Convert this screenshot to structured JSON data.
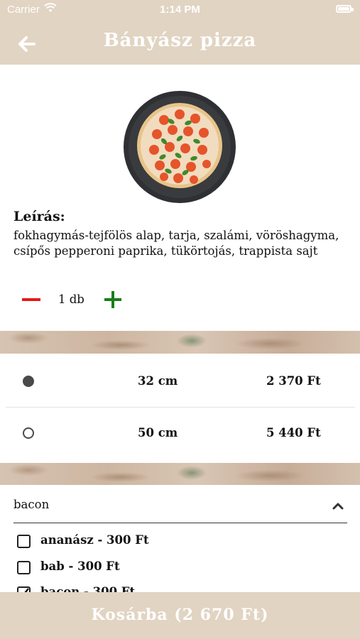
{
  "status_bar": {
    "carrier": "Carrier",
    "time": "1:14 PM"
  },
  "header": {
    "title": "Bányász pizza",
    "back_icon": "arrow-left-icon"
  },
  "product": {
    "image_icon": "pizza-image",
    "description_label": "Leírás:",
    "description": "fokhagymás-tejfölös alap, tarja, szalámi, vöröshagyma, csípős pepperoni paprika, tükörtojás, trappista sajt"
  },
  "quantity": {
    "value": "1 db",
    "minus_color": "#e11b1b",
    "plus_color": "#1b7d1b"
  },
  "sizes": [
    {
      "size": "32 cm",
      "price": "2 370 Ft",
      "selected": true
    },
    {
      "size": "50 cm",
      "price": "5 440 Ft",
      "selected": false
    }
  ],
  "extras": {
    "selected": "bacon",
    "options": [
      {
        "label": "ananász - 300 Ft",
        "checked": false
      },
      {
        "label": "bab - 300 Ft",
        "checked": false
      },
      {
        "label": "bacon - 300 Ft",
        "checked": true
      }
    ]
  },
  "cart": {
    "label": "Kosárba (2 670 Ft)"
  },
  "colors": {
    "accent": "#e1d4c2"
  }
}
